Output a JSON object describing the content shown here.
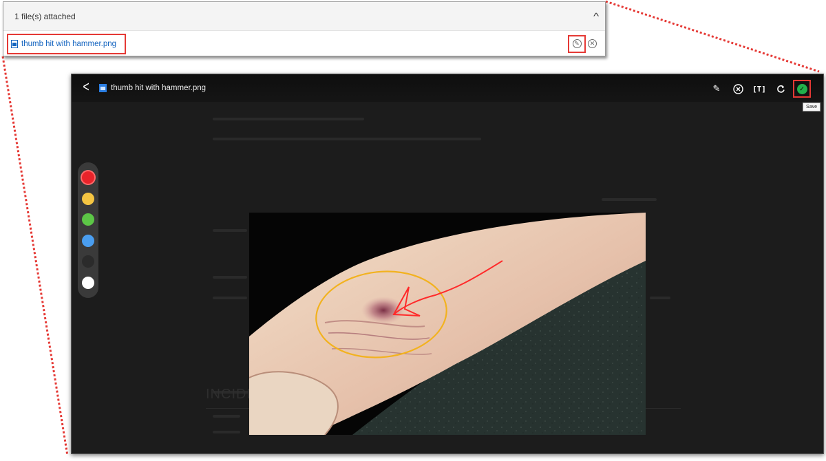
{
  "attachments": {
    "header": "1 file(s) attached",
    "file_name": "thumb hit with hammer.png"
  },
  "editor": {
    "file_name": "thumb hit with hammer.png",
    "save_tooltip": "Save",
    "background_heading": "INCIDE"
  },
  "palette": [
    {
      "name": "red",
      "color": "#e8232a",
      "selected": true
    },
    {
      "name": "yellow",
      "color": "#f5c542",
      "selected": false
    },
    {
      "name": "green",
      "color": "#5cc646",
      "selected": false
    },
    {
      "name": "blue",
      "color": "#4a9ef0",
      "selected": false
    },
    {
      "name": "black",
      "color": "#2b2b2b",
      "selected": false
    },
    {
      "name": "white",
      "color": "#ffffff",
      "selected": false
    }
  ],
  "colors": {
    "highlight": "#e53935",
    "link": "#1565c0",
    "save_green": "#22b14c",
    "annotation_red": "#ff2a2a",
    "annotation_yellow": "#f2b21f"
  },
  "icons": [
    "file-image-icon",
    "chevron-up-icon",
    "pencil-icon",
    "close-circle-icon",
    "back-arrow-icon",
    "text-tool-icon",
    "rotate-icon",
    "check-circle-icon"
  ]
}
